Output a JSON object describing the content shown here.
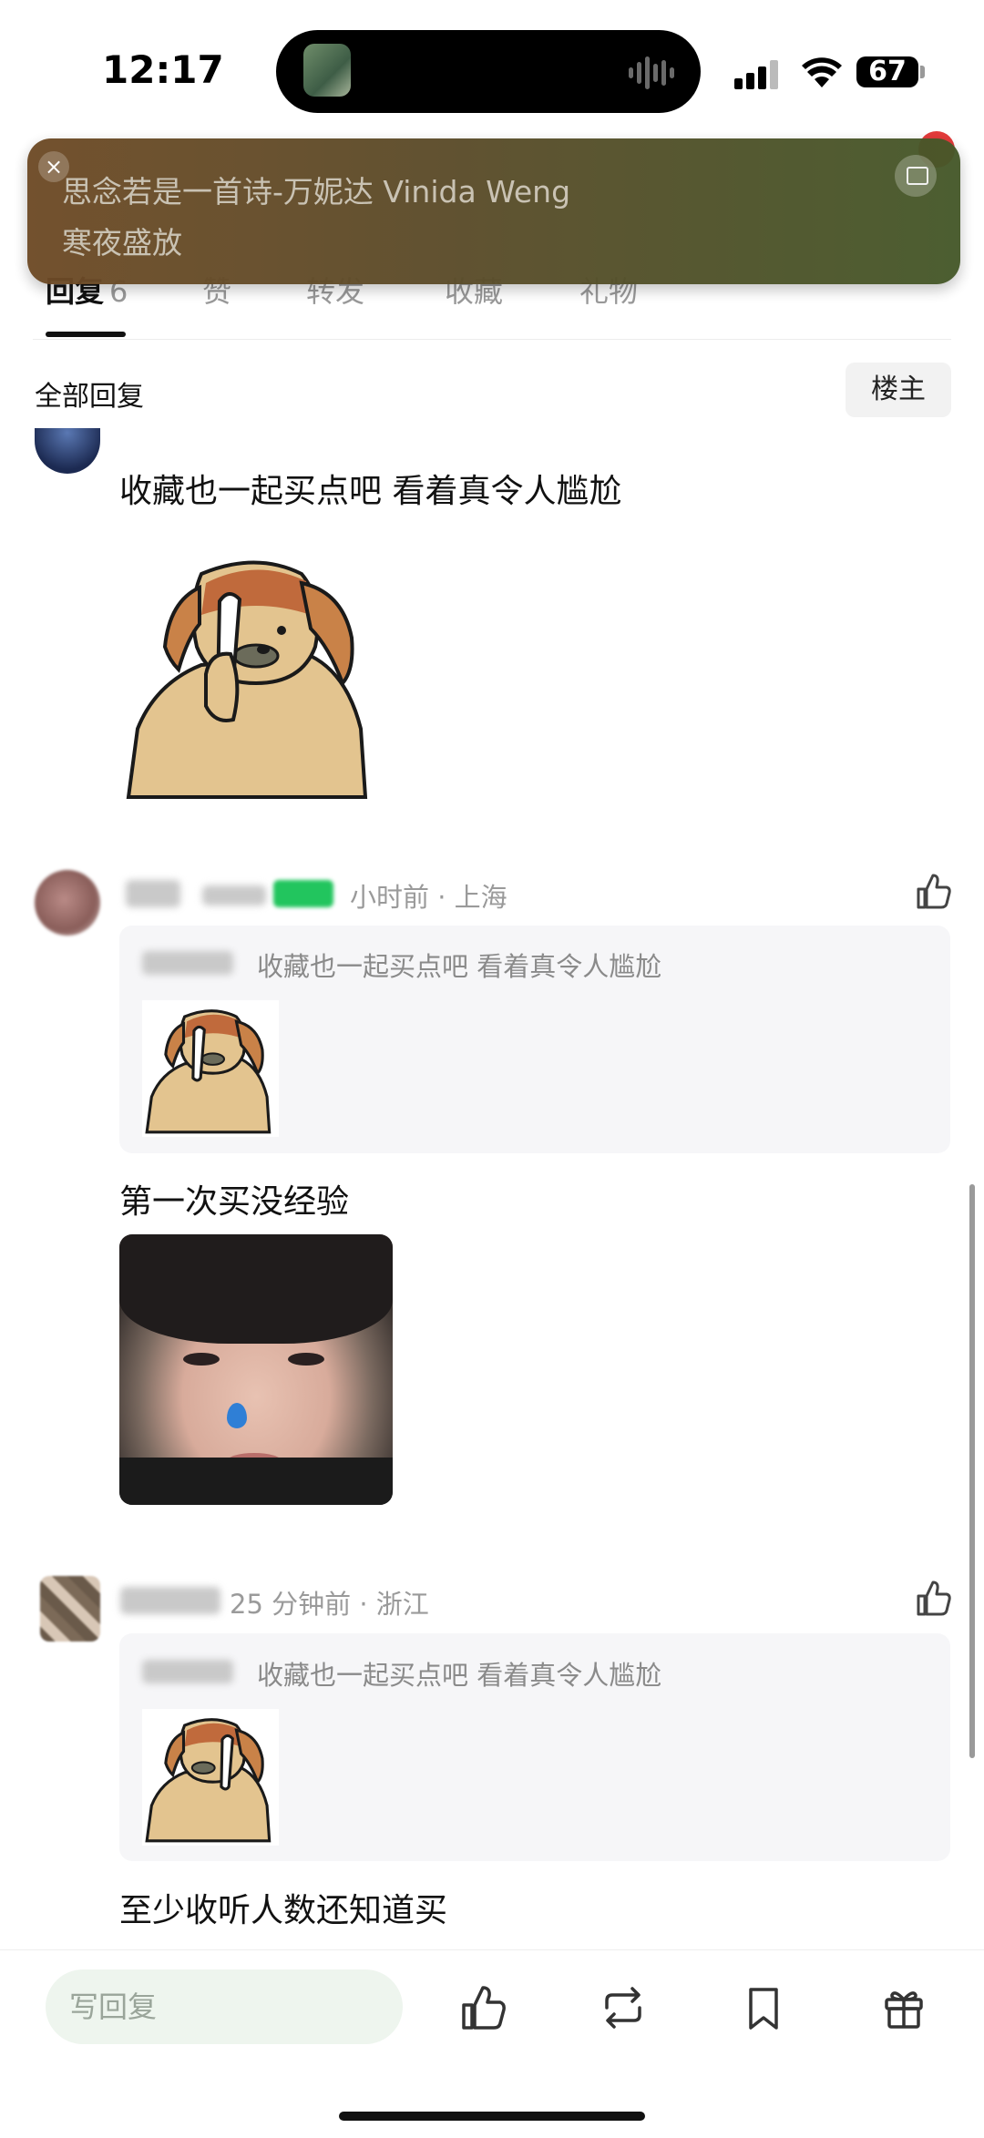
{
  "status_bar": {
    "time": "12:17",
    "battery": "67"
  },
  "tabs": [
    {
      "label": "回复",
      "count": "6",
      "active": true
    },
    {
      "label": "赞"
    },
    {
      "label": "转发"
    },
    {
      "label": "收藏"
    },
    {
      "label": "礼物"
    }
  ],
  "banner": {
    "song": "思念若是一首诗-万妮达 Vinida Weng",
    "subtitle": "寒夜盛放"
  },
  "section": {
    "title": "全部回复",
    "floor_owner": "楼主"
  },
  "comments": [
    {
      "text": "收藏也一起买点吧 看着真令人尴尬"
    },
    {
      "meta": "小时前 · 上海",
      "quote": "收藏也一起买点吧 看着真令人尴尬",
      "text": "第一次买没经验"
    },
    {
      "meta": "25 分钟前 · 浙江",
      "quote": "收藏也一起买点吧 看着真令人尴尬",
      "text": "至少收听人数还知道买"
    }
  ],
  "bottom_bar": {
    "reply_placeholder": "写回复"
  },
  "colors": {
    "accent_green": "#22c55e",
    "banner_bg": "#5b4c29"
  }
}
